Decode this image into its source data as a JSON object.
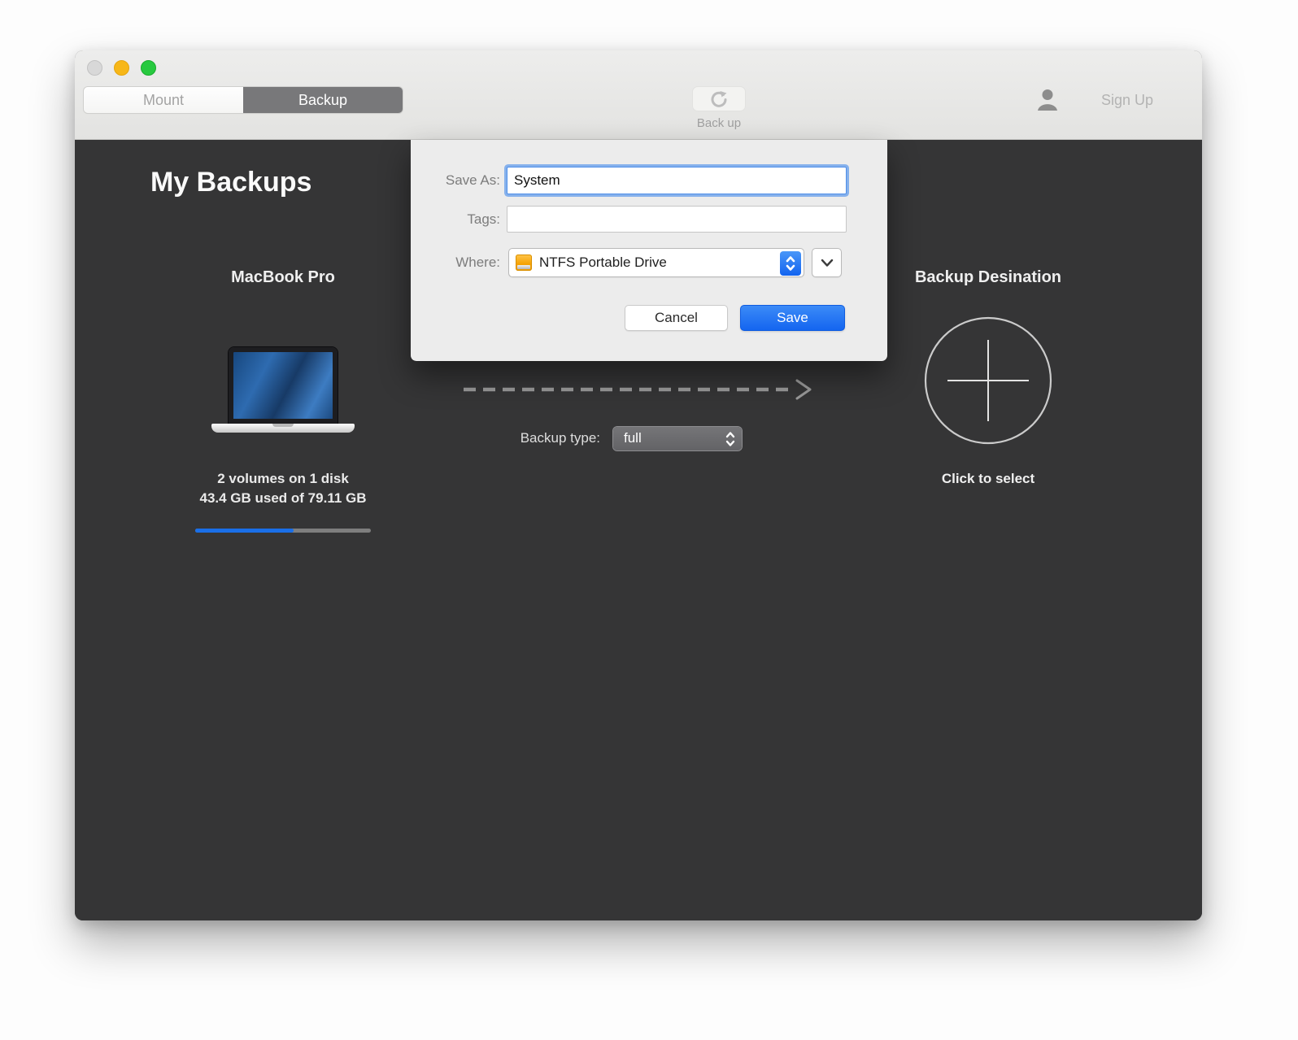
{
  "window": {
    "controls": {
      "close": "window-close",
      "minimize": "window-minimize",
      "zoom": "window-zoom"
    },
    "toolbar": {
      "tabs": [
        {
          "label": "Mount",
          "active": false
        },
        {
          "label": "Backup",
          "active": true
        }
      ],
      "backup_action_label": "Back up",
      "signup_label": "Sign Up",
      "icons": {
        "backup_action": "circular-arrow-icon",
        "account": "person-silhouette-icon"
      }
    },
    "main": {
      "title": "My Backups",
      "source": {
        "name": "MacBook Pro",
        "volumes_line": "2 volumes on 1 disk",
        "usage_line": "43.4 GB used of 79.11 GB",
        "used_percent": 56
      },
      "backup_type": {
        "label": "Backup type:",
        "value": "full"
      },
      "destination": {
        "title": "Backup Desination",
        "hint": "Click to select",
        "icon": "plus-in-circle-icon"
      }
    },
    "sheet": {
      "save_as_label": "Save As:",
      "save_as_value": "System",
      "tags_label": "Tags:",
      "tags_value": "",
      "where_label": "Where:",
      "where_value": "NTFS Portable Drive",
      "where_icon": "orange-drive-icon",
      "cancel_label": "Cancel",
      "save_label": "Save"
    },
    "colors": {
      "accent_blue": "#1465f0",
      "progress_blue": "#1a6fe8",
      "drive_orange": "#f6a406",
      "dark_background": "#353536",
      "traffic_gray": "#d8d8d8",
      "traffic_yellow": "#f7b718",
      "traffic_green": "#27c93f"
    }
  }
}
